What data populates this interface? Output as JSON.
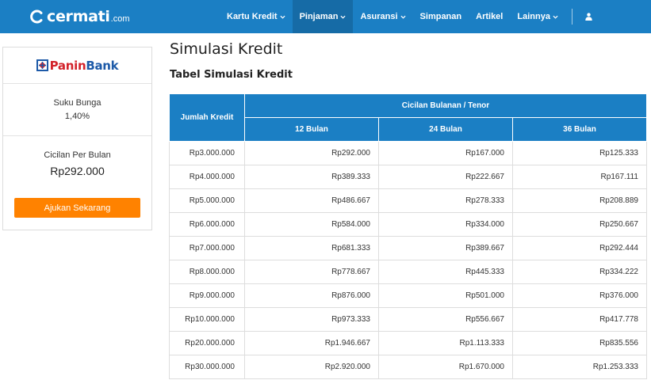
{
  "header": {
    "logo_text": "cermati",
    "logo_suffix": ".com",
    "nav": [
      {
        "label": "Kartu Kredit",
        "dropdown": true,
        "active": false
      },
      {
        "label": "Pinjaman",
        "dropdown": true,
        "active": true
      },
      {
        "label": "Asuransi",
        "dropdown": true,
        "active": false
      },
      {
        "label": "Simpanan",
        "dropdown": false,
        "active": false
      },
      {
        "label": "Artikel",
        "dropdown": false,
        "active": false
      },
      {
        "label": "Lainnya",
        "dropdown": true,
        "active": false
      }
    ],
    "user_icon": "user-icon"
  },
  "card": {
    "bank_name_part1": "Panin",
    "bank_name_part2": "Bank",
    "rate_label": "Suku Bunga",
    "rate_value": "1,40%",
    "install_label": "Cicilan Per Bulan",
    "install_value": "Rp292.000",
    "apply_label": "Ajukan Sekarang"
  },
  "main": {
    "title": "Simulasi Kredit",
    "subtitle": "Tabel Simulasi Kredit"
  },
  "table": {
    "col_kredit": "Jumlah Kredit",
    "col_group": "Cicilan Bulanan / Tenor",
    "tenors": [
      "12 Bulan",
      "24 Bulan",
      "36 Bulan"
    ],
    "rows": [
      {
        "kredit": "Rp3.000.000",
        "t12": "Rp292.000",
        "t24": "Rp167.000",
        "t36": "Rp125.333"
      },
      {
        "kredit": "Rp4.000.000",
        "t12": "Rp389.333",
        "t24": "Rp222.667",
        "t36": "Rp167.111"
      },
      {
        "kredit": "Rp5.000.000",
        "t12": "Rp486.667",
        "t24": "Rp278.333",
        "t36": "Rp208.889"
      },
      {
        "kredit": "Rp6.000.000",
        "t12": "Rp584.000",
        "t24": "Rp334.000",
        "t36": "Rp250.667"
      },
      {
        "kredit": "Rp7.000.000",
        "t12": "Rp681.333",
        "t24": "Rp389.667",
        "t36": "Rp292.444"
      },
      {
        "kredit": "Rp8.000.000",
        "t12": "Rp778.667",
        "t24": "Rp445.333",
        "t36": "Rp334.222"
      },
      {
        "kredit": "Rp9.000.000",
        "t12": "Rp876.000",
        "t24": "Rp501.000",
        "t36": "Rp376.000"
      },
      {
        "kredit": "Rp10.000.000",
        "t12": "Rp973.333",
        "t24": "Rp556.667",
        "t36": "Rp417.778"
      },
      {
        "kredit": "Rp20.000.000",
        "t12": "Rp1.946.667",
        "t24": "Rp1.113.333",
        "t36": "Rp835.556"
      },
      {
        "kredit": "Rp30.000.000",
        "t12": "Rp2.920.000",
        "t24": "Rp1.670.000",
        "t36": "Rp1.253.333"
      }
    ]
  },
  "colors": {
    "brand_blue": "#1b7fc4",
    "nav_active": "#166ba6",
    "accent_orange": "#ff8200",
    "panin_red": "#d3222a",
    "panin_blue": "#1d5aa8"
  }
}
